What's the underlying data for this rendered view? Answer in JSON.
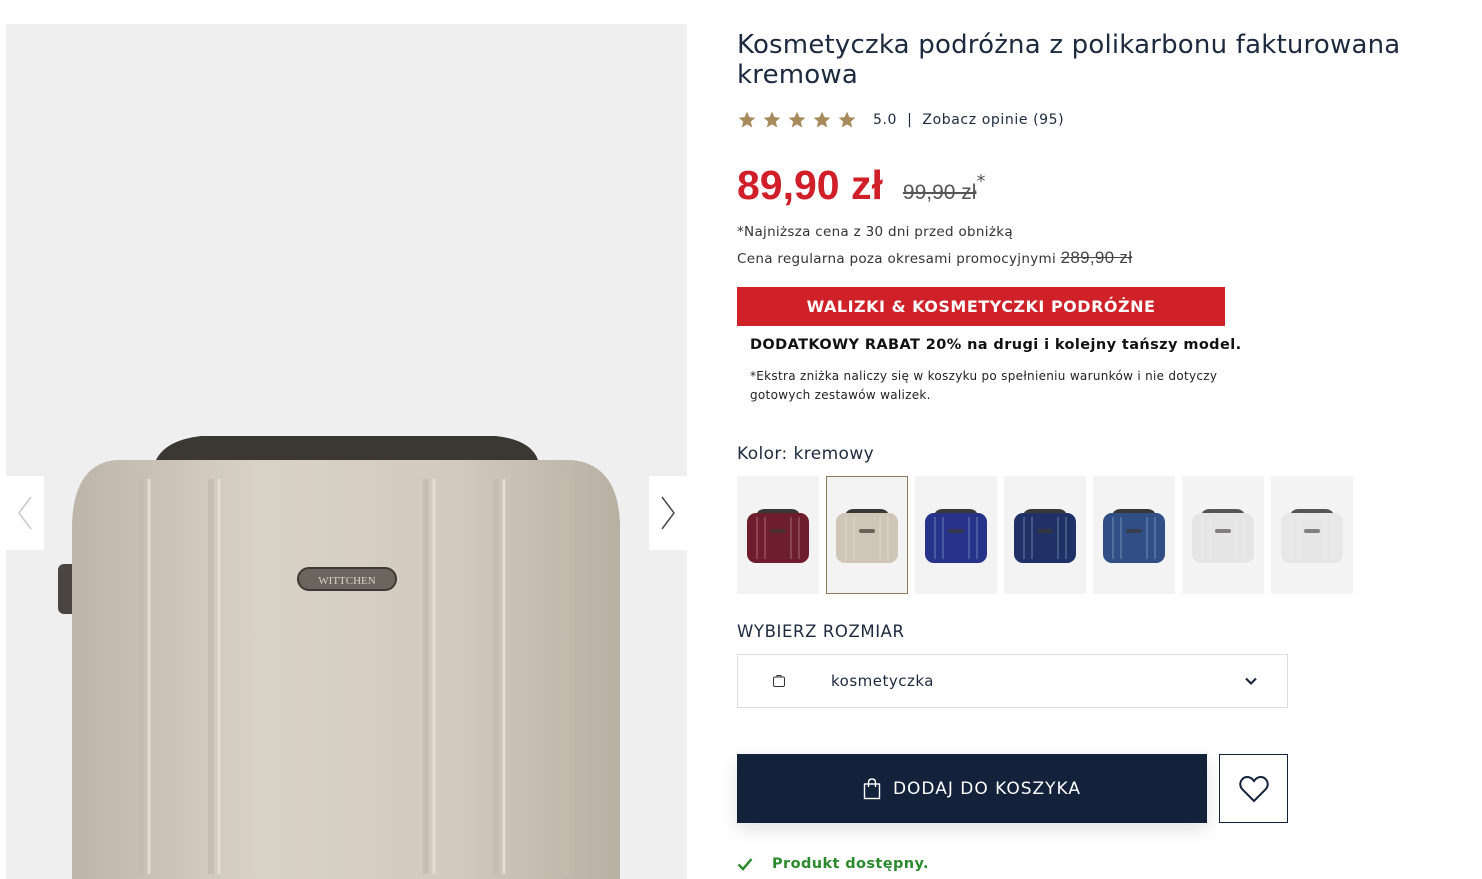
{
  "product": {
    "title": "Kosmetyczka podróżna z polikarbonu fakturowana kremowa",
    "rating": "5.0",
    "rating_separator": "|",
    "reviews_link": "Zobacz opinie (95)",
    "price_current": "89,90 zł",
    "price_old": "99,90 zł",
    "price_asterisk": "*",
    "lowest_price_note": "*Najniższa cena z 30 dni przed obniżką",
    "regular_price_label": "Cena regularna poza okresami promocyjnymi",
    "regular_price_value": "289,90 zł",
    "brand_plate_text": "WITTCHEN"
  },
  "promo": {
    "banner": "WALIZKI & KOSMETYCZKI PODRÓŻNE",
    "main": "DODATKOWY RABAT 20% na drugi i kolejny tańszy model.",
    "note": "*Ekstra zniżka naliczy się w koszyku po spełnieniu warunków i nie dotyczy gotowych zestawów walizek."
  },
  "color": {
    "label": "Kolor: kremowy",
    "swatches": [
      {
        "color": "#6e1d2c",
        "selected": false
      },
      {
        "color": "#cfc6b8",
        "selected": true
      },
      {
        "color": "#27338a",
        "selected": false
      },
      {
        "color": "#1f3167",
        "selected": false
      },
      {
        "color": "#2f4f86",
        "selected": false
      },
      {
        "color": "#e1e1e1",
        "selected": false
      },
      {
        "color": "#e3e3e3",
        "selected": false
      }
    ]
  },
  "size": {
    "label": "WYBIERZ ROZMIAR",
    "selected": "kosmetyczka"
  },
  "actions": {
    "add_to_cart": "DODAJ DO KOSZYKA"
  },
  "availability": "Produkt dostępny.",
  "colors": {
    "price_red": "#d11f2a",
    "banner_red": "#cf2127",
    "navy": "#14213b",
    "star_gold": "#a88b5c",
    "available_green": "#2c8a2e"
  }
}
